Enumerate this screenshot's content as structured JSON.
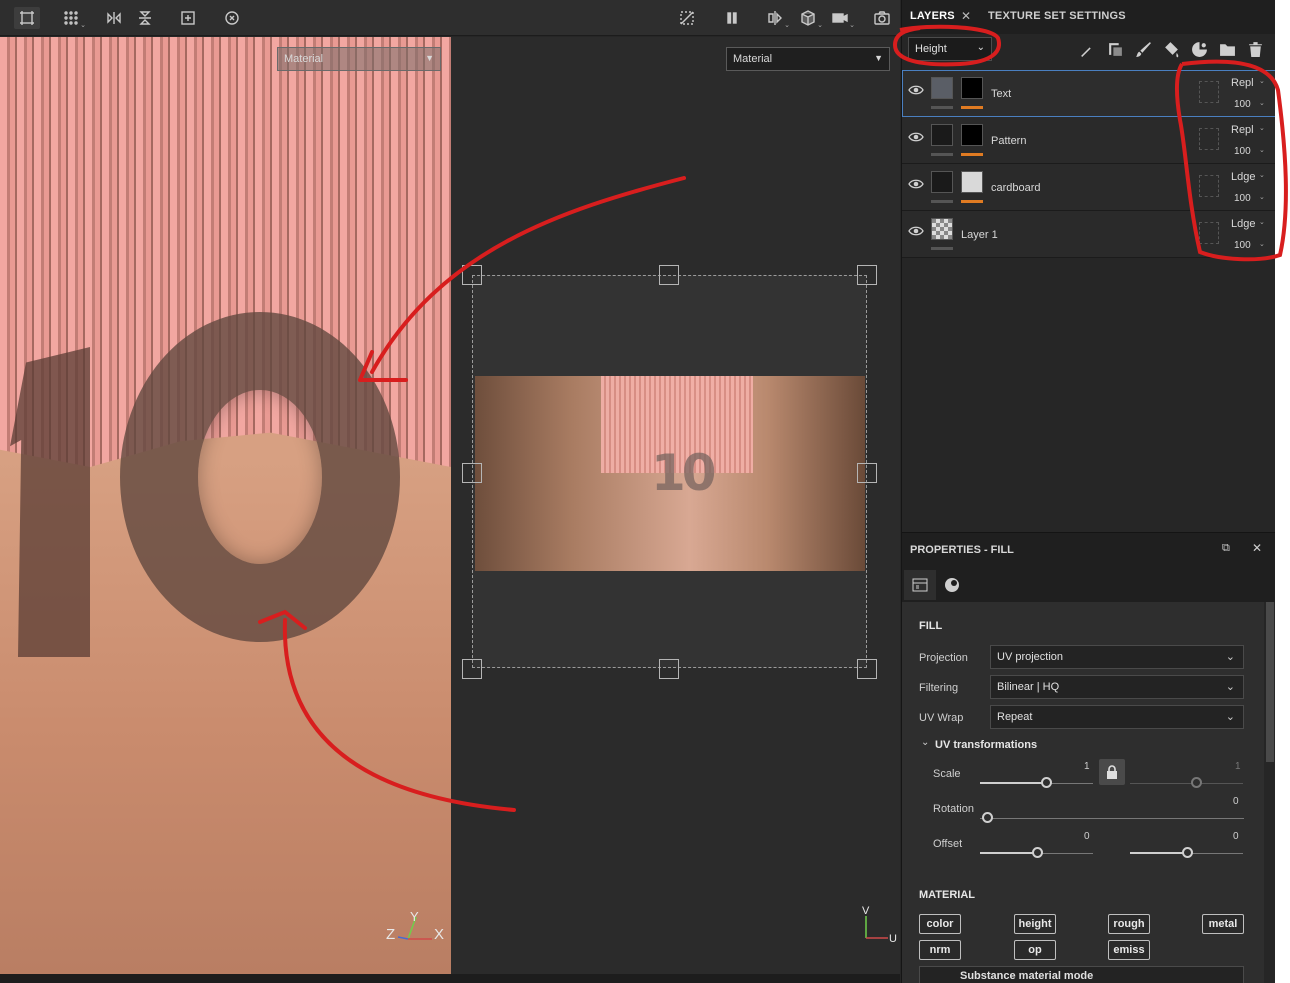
{
  "viewport_3d": {
    "material_select": "Material",
    "axis_labels": [
      "Z",
      "Y",
      "X"
    ]
  },
  "viewport_2d": {
    "material_select": "Material",
    "texture_text": "10",
    "axis_labels": [
      "V",
      "U"
    ]
  },
  "tabs": {
    "layers": "LAYERS",
    "texture_set_settings": "TEXTURE SET SETTINGS"
  },
  "channel_select": "Height",
  "layers": [
    {
      "name": "Text",
      "blend": "Repl",
      "opacity": "100",
      "selected": true
    },
    {
      "name": "Pattern",
      "blend": "Repl",
      "opacity": "100",
      "selected": false
    },
    {
      "name": "cardboard",
      "blend": "Ldge",
      "opacity": "100",
      "selected": false
    },
    {
      "name": "Layer 1",
      "blend": "Ldge",
      "opacity": "100",
      "selected": false
    }
  ],
  "properties": {
    "title": "PROPERTIES - FILL",
    "fill_title": "FILL",
    "projection": {
      "label": "Projection",
      "value": "UV projection"
    },
    "filtering": {
      "label": "Filtering",
      "value": "Bilinear | HQ"
    },
    "uv_wrap": {
      "label": "UV Wrap",
      "value": "Repeat"
    },
    "uv_transform_title": "UV transformations",
    "scale": {
      "label": "Scale",
      "value1": "1",
      "value2": "1"
    },
    "rotation": {
      "label": "Rotation",
      "value": "0"
    },
    "offset": {
      "label": "Offset",
      "value1": "0",
      "value2": "0"
    },
    "material_title": "MATERIAL",
    "channels": [
      "color",
      "height",
      "rough",
      "metal",
      "nrm",
      "op",
      "emiss"
    ],
    "substance_mode": "Substance material mode"
  },
  "colors": {
    "annotation": "#d81e1e",
    "selection": "#4a7fc0",
    "mask_bar": "#e07b22"
  }
}
